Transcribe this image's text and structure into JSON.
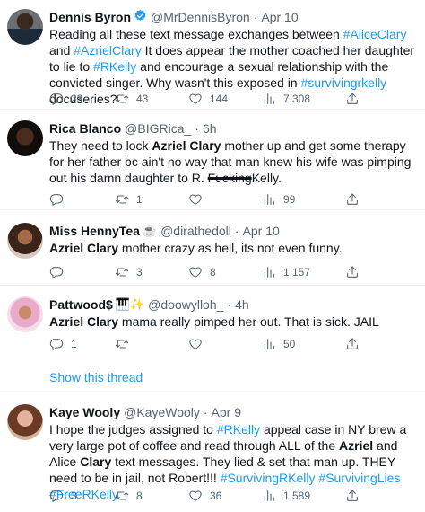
{
  "tweets": [
    {
      "name": "Dennis Byron",
      "handle": "@MrDennisByron",
      "time": "Apr 10",
      "verified": true,
      "text_parts": {
        "p1": "Reading all these text message exchanges between ",
        "p2": "#AliceClary",
        "p3": " and ",
        "p4": "#AzrielClary",
        "p5": " It does appear the mother coached her daughter to lie to ",
        "p6": "#RKelly",
        "p7": " and encourage a sexual relationship with the convicted singer. Why wasn't this exposed in ",
        "p8": "#survivingrkelly",
        "p9": " docuseries?"
      },
      "replies": "23",
      "retweets": "43",
      "likes": "144",
      "views": "7,308"
    },
    {
      "name": "Rica Blanco",
      "handle": "@BIGRica_",
      "time": "6h",
      "text_parts": {
        "p1": "They need to lock ",
        "p2": "Azriel Clary",
        "p3": " mother up and get some therapy for her father bc ain't no way that man knew his wife was pimping out his damn daughter to R. ",
        "p4": "Fucking",
        "p5": "Kelly."
      },
      "replies": "",
      "retweets": "1",
      "likes": "",
      "views": "99"
    },
    {
      "name": "Miss HennyTea",
      "emoji": "☕",
      "handle": "@dirathedoll",
      "time": "Apr 10",
      "text_parts": {
        "p1": "Azriel Clary",
        "p2": " mother crazy as hell, its not even funny."
      },
      "replies": "",
      "retweets": "3",
      "likes": "8",
      "views": "1,157"
    },
    {
      "name": "Pattwood$",
      "emoji": "🎹✨",
      "handle": "@doowylloh_",
      "time": "4h",
      "text_parts": {
        "p1": "Azriel Clary",
        "p2": " mama really pimped her out. That is sick. JAIL"
      },
      "replies": "1",
      "retweets": "",
      "likes": "",
      "views": "50"
    },
    {
      "name": "Kaye Wooly",
      "handle": "@KayeWooly",
      "time": "Apr 9",
      "text_parts": {
        "p1": "I hope the judges assigned to ",
        "p2": "#RKelly",
        "p3": " appeal case in NY brew a very large pot of coffee and read through ALL of the ",
        "p4": "Azriel",
        "p5": " and Alice ",
        "p6": "Clary",
        "p7": " text messages. They lied & set that man up. THEY need to be in jail, not Robert!!! ",
        "p8": "#SurvivingRKelly",
        "p9": " ",
        "p10": "#SurvivingLies",
        "p11": " ",
        "p12": "#FreeRKelly"
      },
      "replies": "3",
      "retweets": "8",
      "likes": "36",
      "views": "1,589"
    }
  ],
  "show_thread": "Show this thread",
  "dot": "·",
  "icons": {
    "reply": "reply-icon",
    "retweet": "retweet-icon",
    "like": "heart-icon",
    "views": "views-icon",
    "share": "share-icon",
    "verified": "verified-badge-icon"
  },
  "colors": {
    "link": "#1d9bf0",
    "muted": "#536471",
    "text": "#0f1419",
    "divider": "#eff3f4"
  }
}
